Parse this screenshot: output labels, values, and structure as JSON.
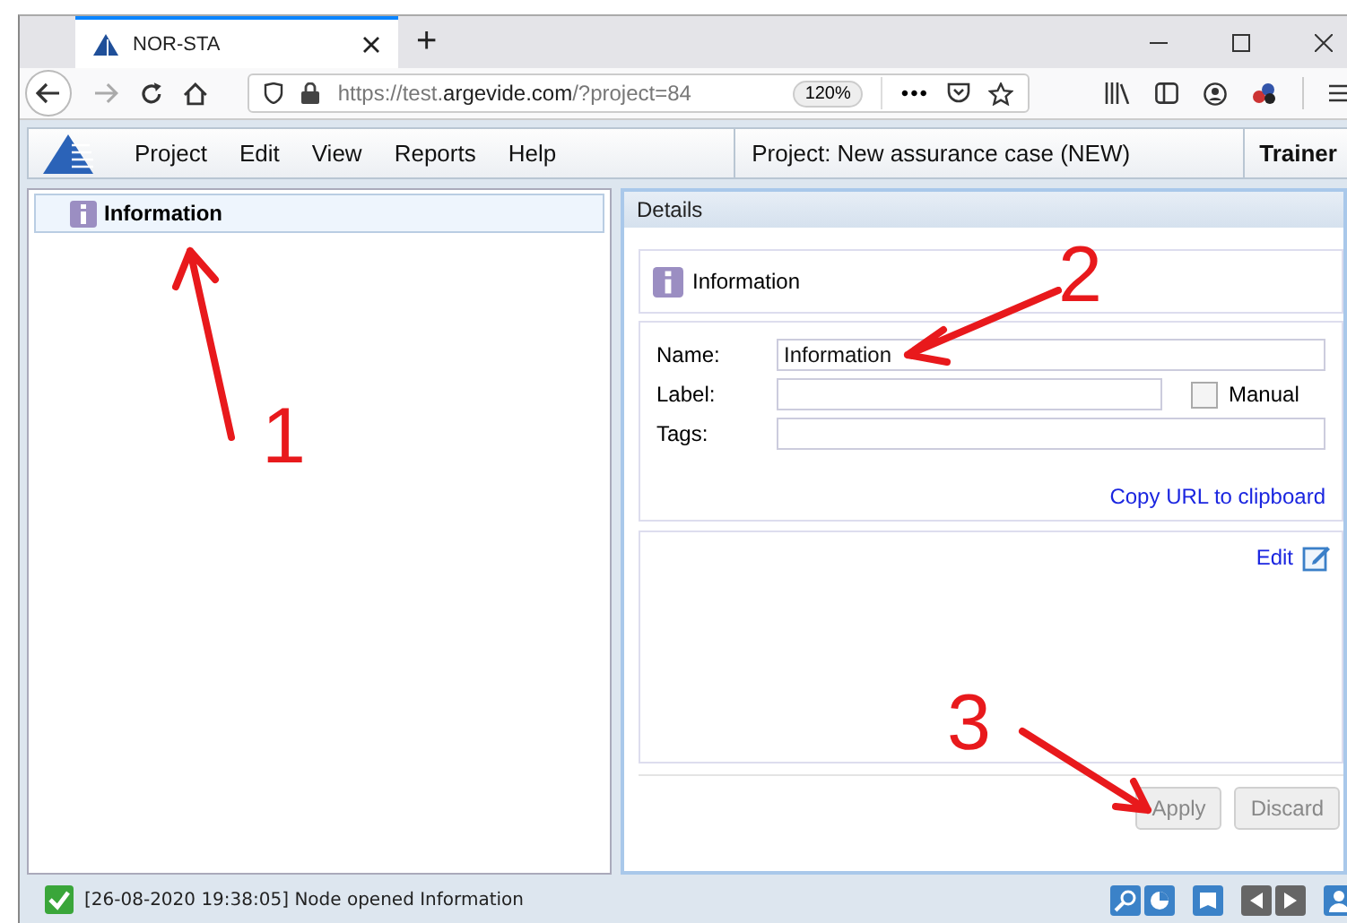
{
  "browser": {
    "tab": {
      "title": "NOR-STA",
      "selected": true
    },
    "new_tab": "+",
    "url": {
      "prefix": "https://test.",
      "domain": "argevide.com",
      "path": "/?project=84"
    },
    "zoom": "120%",
    "page_actions": "•••"
  },
  "menu": [
    {
      "label": "Project"
    },
    {
      "label": "Edit"
    },
    {
      "label": "View"
    },
    {
      "label": "Reports"
    },
    {
      "label": "Help"
    }
  ],
  "project_title": "Project: New assurance case (NEW)",
  "user": "Trainer",
  "tree": {
    "items": [
      {
        "label": "Information",
        "selected": true
      }
    ]
  },
  "details": {
    "header": "Details",
    "node_title": "Information",
    "fields": [
      {
        "label": "Name:",
        "value": "Information"
      },
      {
        "label": "Label:"
      },
      {
        "label": "Tags:"
      }
    ],
    "manual": {
      "label": "Manual",
      "checked": false
    },
    "copy_link": "Copy URL to clipboard",
    "edit_link": "Edit",
    "buttons": [
      {
        "label": "Apply",
        "disabled": true
      },
      {
        "label": "Discard",
        "disabled": true
      }
    ]
  },
  "status": {
    "message": "[26-08-2020 19:38:05] Node opened Information"
  },
  "annotations": [
    {
      "label": "1"
    },
    {
      "label": "2"
    },
    {
      "label": "3"
    }
  ]
}
